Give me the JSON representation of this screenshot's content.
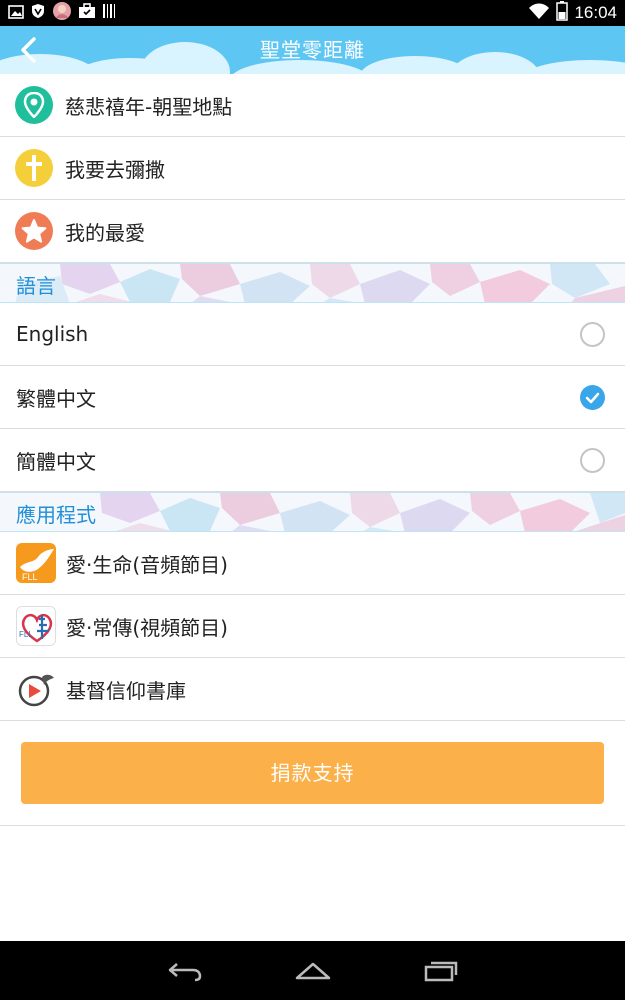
{
  "status_bar": {
    "time": "16:04",
    "left_icons": [
      "image-icon",
      "shield-icon",
      "app-avatar-icon",
      "briefcase-icon",
      "barcode-icon"
    ],
    "right_icons": [
      "wifi-icon",
      "battery-icon"
    ]
  },
  "header": {
    "title": "聖堂零距離",
    "back_icon": "chevron-left-icon",
    "bg_color": "#5ec6f3"
  },
  "menu": [
    {
      "label": "慈悲禧年-朝聖地點",
      "icon": "location-pin-icon",
      "color": "#1fbf9c"
    },
    {
      "label": "我要去彌撒",
      "icon": "cross-icon",
      "color": "#f5cf3a"
    },
    {
      "label": "我的最愛",
      "icon": "star-icon",
      "color": "#f07c55"
    }
  ],
  "language_section": {
    "title": "語言",
    "options": [
      {
        "label": "English",
        "selected": false
      },
      {
        "label": "繁體中文",
        "selected": true
      },
      {
        "label": "簡體中文",
        "selected": false
      }
    ]
  },
  "apps_section": {
    "title": "應用程式",
    "apps": [
      {
        "label": "愛‧生命(音頻節目)",
        "icon": "fll-dove-app-icon"
      },
      {
        "label": "愛‧常傳(視頻節目)",
        "icon": "fll-heart-app-icon"
      },
      {
        "label": "基督信仰書庫",
        "icon": "bible-app-icon"
      }
    ]
  },
  "donate_button": {
    "label": "捐款支持",
    "color": "#fbb04a"
  },
  "nav_bar": {
    "icons": [
      "back-nav-icon",
      "home-nav-icon",
      "recents-nav-icon"
    ]
  }
}
